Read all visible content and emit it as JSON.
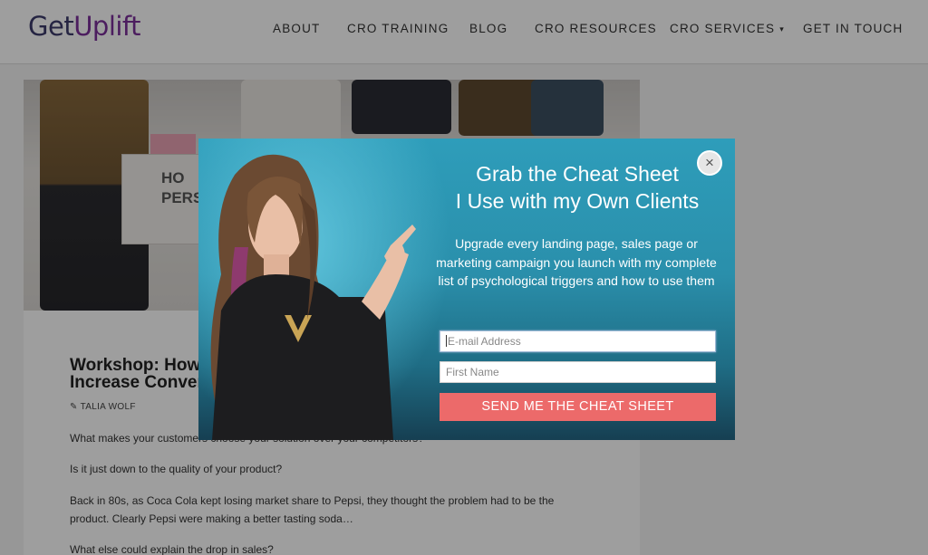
{
  "header": {
    "logo": {
      "part1": "Get",
      "part2": "Uplift"
    },
    "nav": [
      {
        "label": "ABOUT"
      },
      {
        "label": "CRO TRAINING"
      },
      {
        "label": "BLOG"
      },
      {
        "label": "CRO RESOURCES"
      },
      {
        "label": "CRO SERVICES"
      },
      {
        "label": "GET IN TOUCH"
      }
    ],
    "dropdown_icon": "chevron-down-double-icon"
  },
  "article": {
    "hero_text_lines": [
      "HO",
      "PERS"
    ],
    "title_lines": [
      "Workshop: How",
      "Increase Conver"
    ],
    "author": "TALIA WOLF",
    "author_icon": "pencil-icon",
    "paragraphs": [
      "What makes your customers choose your solution over your competitors?",
      "Is it just down to the quality of your product?",
      "Back in 80s, as Coca Cola kept losing market share to Pepsi, they thought the problem had to be the product. Clearly Pepsi were making a better tasting soda…",
      "What else could explain the drop in sales?"
    ]
  },
  "popup": {
    "title_lines": [
      "Grab the Cheat Sheet",
      "I Use with my Own Clients"
    ],
    "body": "Upgrade every landing page, sales page or marketing campaign you launch with my complete list of psychological triggers and how to use them",
    "email_placeholder": "E-mail Address",
    "first_name_placeholder": "First Name",
    "submit_label": "SEND ME THE CHEAT SHEET",
    "close_symbol": "×",
    "colors": {
      "submit": "#ec6a6a",
      "background": "#2e9dba"
    }
  }
}
